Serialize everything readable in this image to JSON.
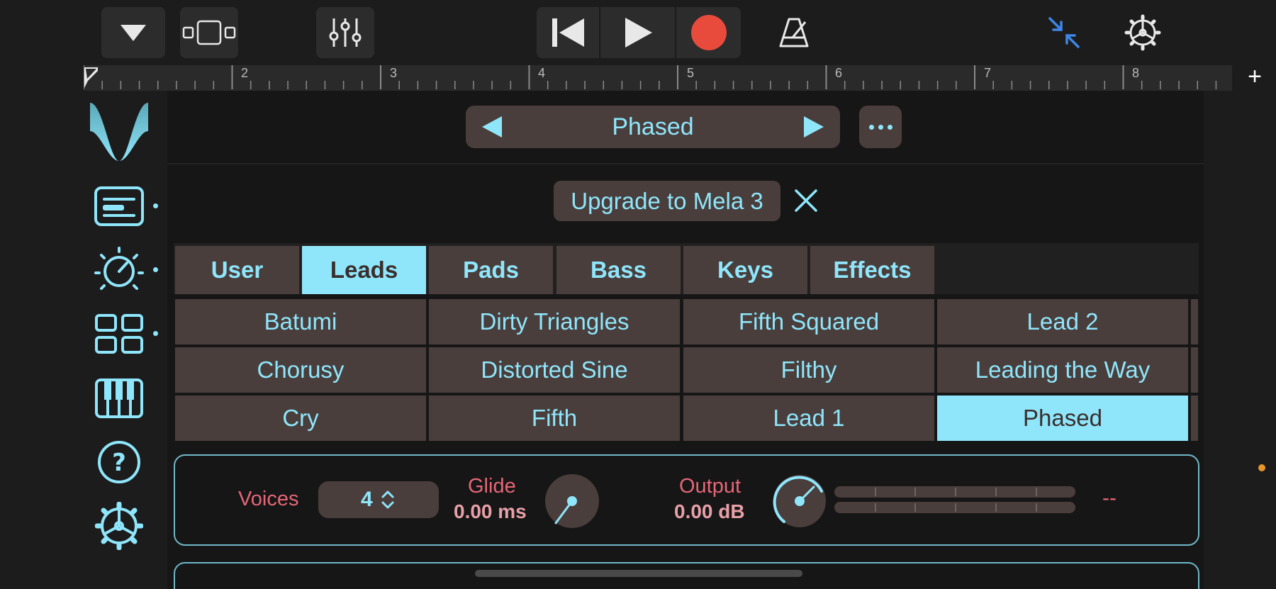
{
  "toolbar": {
    "collapse_icon": "triangle-down-icon",
    "view_icon": "track-view-icon",
    "mixer_icon": "mixer-sliders-icon",
    "rewind_icon": "skip-back-icon",
    "play_icon": "play-icon",
    "record_icon": "record-icon",
    "metronome_icon": "metronome-icon",
    "minimize_icon": "minimize-arrows-icon",
    "settings_icon": "gear-icon",
    "record_color": "#e84a3c",
    "minimize_color": "#3d86e8"
  },
  "ruler": {
    "bars": [
      "2",
      "3",
      "4",
      "5",
      "6",
      "7",
      "8"
    ],
    "add_label": "+"
  },
  "sidebar": {
    "items": [
      {
        "name": "logo",
        "icon": "mela-wave-logo"
      },
      {
        "name": "presets",
        "icon": "preset-card-icon"
      },
      {
        "name": "parameters",
        "icon": "knob-icon"
      },
      {
        "name": "modules",
        "icon": "grid-icon"
      },
      {
        "name": "keyboard",
        "icon": "piano-keys-icon"
      },
      {
        "name": "help",
        "icon": "help-icon"
      },
      {
        "name": "settings",
        "icon": "gear-icon"
      }
    ],
    "accent": "#8fe6fb"
  },
  "preset": {
    "name": "Phased",
    "more_icon": "ellipsis-icon"
  },
  "upgrade": {
    "label": "Upgrade to Mela 3",
    "close_icon": "close-icon"
  },
  "tabs": [
    {
      "label": "User",
      "active": false
    },
    {
      "label": "Leads",
      "active": true
    },
    {
      "label": "Pads",
      "active": false
    },
    {
      "label": "Bass",
      "active": false
    },
    {
      "label": "Keys",
      "active": false
    },
    {
      "label": "Effects",
      "active": false
    }
  ],
  "presets": [
    [
      "Batumi",
      "Dirty Triangles",
      "Fifth Squared",
      "Lead 2"
    ],
    [
      "Chorusy",
      "Distorted Sine",
      "Filthy",
      "Leading the Way"
    ],
    [
      "Cry",
      "Fifth",
      "Lead 1",
      "Phased"
    ]
  ],
  "selected_preset": "Phased",
  "controls": {
    "voices_label": "Voices",
    "voices_value": "4",
    "glide_label": "Glide",
    "glide_value": "0.00 ms",
    "output_label": "Output",
    "output_value": "0.00 dB",
    "meter_readout": "--"
  }
}
